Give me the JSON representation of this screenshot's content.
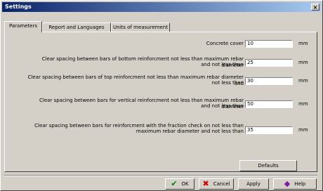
{
  "window": {
    "title": "Settings",
    "close_label": "×"
  },
  "tabs": [
    {
      "label": "Parameters"
    },
    {
      "label": "Report and Languages"
    },
    {
      "label": "Units of measurement"
    }
  ],
  "fields": [
    {
      "label": "Concrete cover",
      "value": "10",
      "unit": "mm"
    },
    {
      "label_line1": "Clear spacing between bars of bottom reinforcment not less than maximum rebar diameter",
      "label_line2": "and not less than",
      "value": "25",
      "unit": "mm"
    },
    {
      "label_line1": "Clear spacing between bars of top reinforcment not less than maximum rebar diameter and",
      "label_line2": "not less than",
      "value": "30",
      "unit": "mm"
    },
    {
      "label_line1": "Clear spacing between bars for vertical reinforcment not less than maximum rebar diameter",
      "label_line2": "and not less than",
      "value": "50",
      "unit": "mm"
    },
    {
      "label_line1": "Clear spacing between bars for reinforcment with the fraction check on not less than",
      "label_line2": "maximum rebar diameter and not less than",
      "value": "35",
      "unit": "mm"
    }
  ],
  "buttons": {
    "defaults": "Defaults",
    "ok": "OK",
    "cancel": "Cancel",
    "apply": "Apply",
    "help": "Help"
  },
  "icons": {
    "ok": "checkmark-icon",
    "cancel": "x-mark-icon",
    "help": "help-icon"
  },
  "colors": {
    "title_start": "#0a246a",
    "title_end": "#a6caf0",
    "ok_icon": "#008000",
    "cancel_icon": "#cc0000",
    "help_icon": "#7a1fa2"
  }
}
